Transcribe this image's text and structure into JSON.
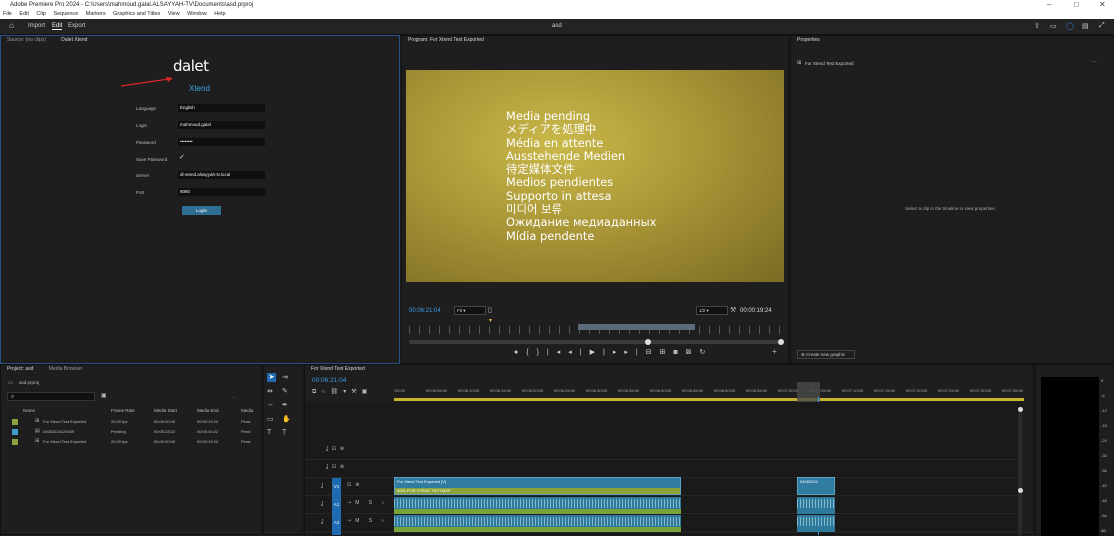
{
  "titlebar": {
    "title": "Adobe Premiere Pro 2024 - C:\\Users\\mahmoud.galal.ALSAYYAH-TV\\Documents\\asd.prproj"
  },
  "menu": [
    "File",
    "Edit",
    "Clip",
    "Sequence",
    "Markers",
    "Graphics and Titles",
    "View",
    "Window",
    "Help"
  ],
  "workspace": {
    "tabs": [
      "Import",
      "Edit",
      "Export"
    ],
    "active": "Edit",
    "center_title": "asd"
  },
  "source_panel": {
    "tabs": [
      "Source: (no clips)",
      "Dalet Xtend"
    ]
  },
  "dalet": {
    "logo": "dalet",
    "product": "Xtend",
    "fields": [
      {
        "label": "Language",
        "value": "English"
      },
      {
        "label": "Login",
        "value": "mahmoud.galal"
      },
      {
        "label": "Password",
        "value": "••••••••"
      }
    ],
    "save_password_label": "Save Password",
    "server_label": "Server",
    "server_value": "dl-xtend.alsayyah-tv.local",
    "port_label": "Port",
    "port_value": "8080",
    "login_button": "Login"
  },
  "program": {
    "tab": "Program: For Xtend Test Exported",
    "messages": [
      "Media pending",
      "メディアを処理中",
      "Média en attente",
      "Ausstehende Medien",
      "待定媒体文件",
      "Medios pendientes",
      "Supporto in attesa",
      "미디어 보류",
      "Ожидание медиаданных",
      "Mídia pendente"
    ],
    "timecode": "00:06:21:04",
    "fit": "Fit",
    "quality": "1/2",
    "duration": "00:00:19:24",
    "playhead_fraction": 0.2
  },
  "properties": {
    "tab": "Properties",
    "sequence": "For Xtend Test Exported",
    "empty_msg": "Select a clip in the timeline to view properties.",
    "button": "Create new graphic"
  },
  "project": {
    "tabs": [
      "Project: asd",
      "Media Browser"
    ],
    "bin": "asd.prproj",
    "columns": [
      "Name",
      "Frame Rate",
      "Media Start",
      "Media End",
      "Media"
    ],
    "rows": [
      {
        "name": "For Xtend Test Exported",
        "rate": "25.00 fps",
        "start": "00:00:00:00",
        "end": "00:00:19:24",
        "media": "Pend"
      },
      {
        "name": "04082024123039",
        "rate": "Pending",
        "start": "00:05:23:22",
        "end": "00:05:40:22",
        "media": "Pend"
      },
      {
        "name": "For Xtend Test Exported",
        "rate": "25.00 fps",
        "start": "00:00:00:00",
        "end": "00:00:19:24",
        "media": "Pend"
      }
    ]
  },
  "timeline": {
    "tab": "For Xtend Test Exported",
    "timecode": "00:06:21:04",
    "ruler": [
      ":00:00",
      "00:06:05:00",
      "00:06:10:00",
      "00:06:15:00",
      "00:06:20:00",
      "00:06:25:00",
      "00:06:30:00",
      "00:06:35:00",
      "00:06:40:00",
      "00:06:45:00",
      "00:06:50:00",
      "00:06:55:00",
      "00:07:00:00",
      "00:07:05:00",
      "00:07:10:00",
      "00:07:15:00",
      "00:07:20:00",
      "00:07:25:00",
      "00:07:30:00",
      "00:07:35:00"
    ],
    "tracks": [
      {
        "id": "V3",
        "label": "V3"
      },
      {
        "id": "V2",
        "label": "V2"
      },
      {
        "id": "V1",
        "label": "V1"
      },
      {
        "id": "A1",
        "label": "A1"
      },
      {
        "id": "A2",
        "label": "A2"
      }
    ],
    "clip_v1_main": "For Xtend Test Exported [V]",
    "clip_v1_sub": "0001 FOR XTEND TEST.MXF",
    "clip_v1_right": "04082024",
    "clip_a_label": "For Xtend Test Exported"
  },
  "meter_scale": [
    "0",
    "-6",
    "-12",
    "-18",
    "-24",
    "-30",
    "-36",
    "-42",
    "-48",
    "-54",
    "dB"
  ]
}
